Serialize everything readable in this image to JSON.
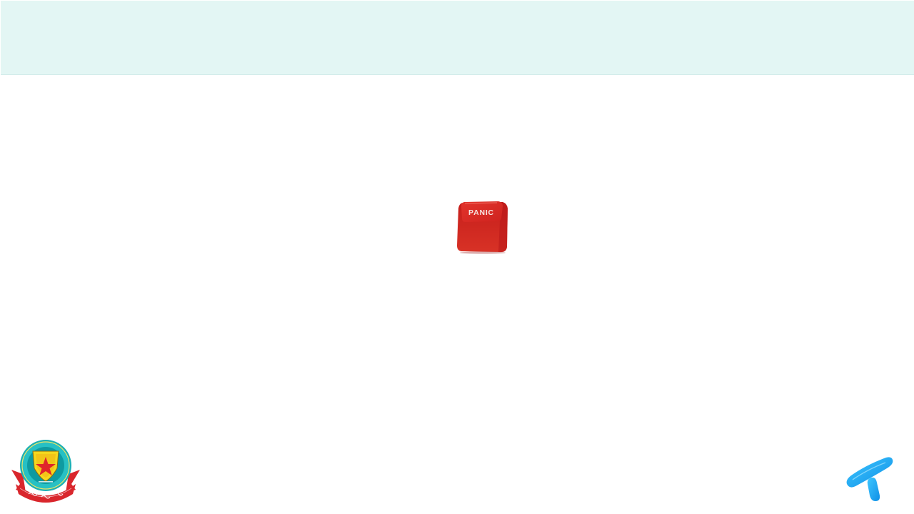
{
  "slide": {
    "header_band_color": "#e3f6f4",
    "panic_key": {
      "label": "PANIC",
      "color": "#d42a24",
      "icon": "panic-keycap-icon"
    },
    "logos": {
      "left": {
        "icon": "police-emblem-icon",
        "ribbon_color": "#d9262c",
        "star_color": "#e0242b",
        "shield_color": "#f5d81e"
      },
      "right": {
        "icon": "telenor-logo-icon",
        "color": "#19aaf8"
      }
    }
  }
}
